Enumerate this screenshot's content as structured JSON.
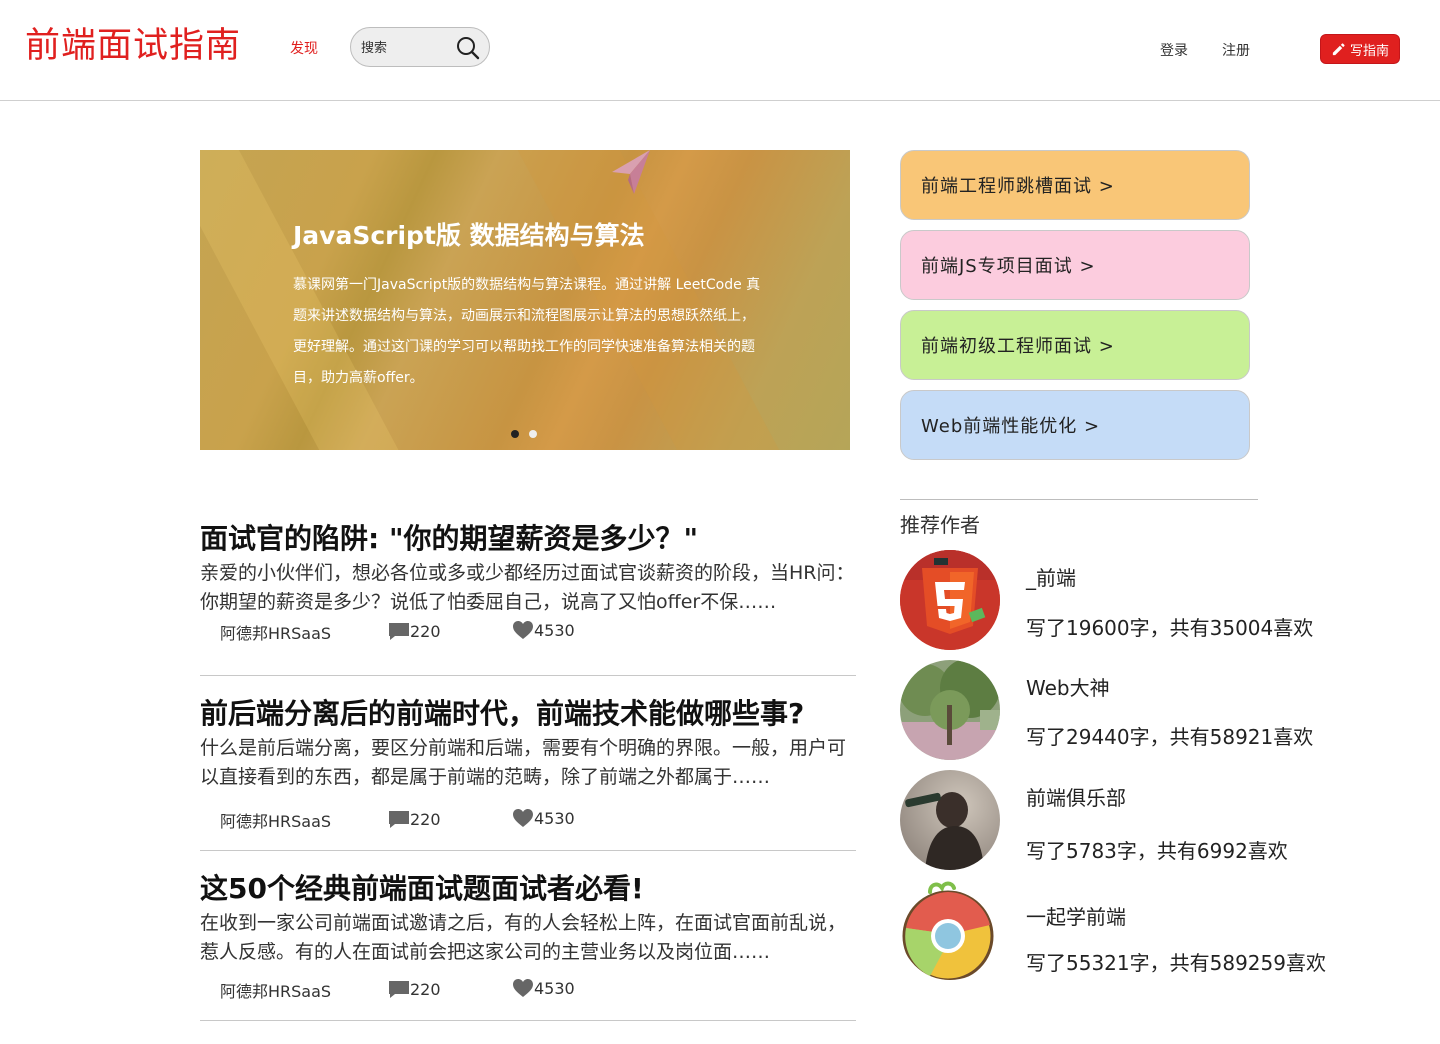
{
  "header": {
    "logo": "前端面试指南",
    "nav_discover": "发现",
    "search_placeholder": "搜索",
    "login": "登录",
    "register": "注册",
    "write_label": "写指南"
  },
  "banner": {
    "title": "JavaScript版 数据结构与算法",
    "description": "慕课网第一门JavaScript版的数据结构与算法课程。通过讲解 LeetCode 真题来讲述数据结构与算法，动画展示和流程图展示让算法的思想跃然纸上，更好理解。通过这门课的学习可以帮助找工作的同学快速准备算法相关的题目，助力高薪offer。",
    "active_slide": 1,
    "slide_count": 2
  },
  "categories": [
    {
      "label": "前端工程师跳槽面试 >",
      "color": "#f9c677"
    },
    {
      "label": "前端JS专项目面试 >",
      "color": "#fcccde"
    },
    {
      "label": "前端初级工程师面试 >",
      "color": "#c8f096"
    },
    {
      "label": "Web前端性能优化 >",
      "color": "#c5dcf7"
    }
  ],
  "articles": [
    {
      "title": "面试官的陷阱: \"你的期望薪资是多少？\"",
      "summary": "亲爱的小伙伴们，想必各位或多或少都经历过面试官谈薪资的阶段，当HR问：你期望的薪资是多少？说低了怕委屈自己，说高了又怕offer不保……",
      "author": "阿德邦HRSaaS",
      "comments": "220",
      "likes": "4530"
    },
    {
      "title": "前后端分离后的前端时代，前端技术能做哪些事?",
      "summary": "什么是前后端分离，要区分前端和后端，需要有个明确的界限。一般，用户可以直接看到的东西，都是属于前端的范畴，除了前端之外都属于……",
      "author": "阿德邦HRSaaS",
      "comments": "220",
      "likes": "4530"
    },
    {
      "title": "这50个经典前端面试题面试者必看!",
      "summary": "在收到一家公司前端面试邀请之后，有的人会轻松上阵，在面试官面前乱说，惹人反感。有的人在面试前会把这家公司的主营业务以及岗位面……",
      "author": "阿德邦HRSaaS",
      "comments": "220",
      "likes": "4530"
    }
  ],
  "authors_section": {
    "title": "推荐作者",
    "authors": [
      {
        "name": "_前端",
        "stats": "写了19600字，共有35004喜欢",
        "avatar": "html5-logo"
      },
      {
        "name": "Web大神",
        "stats": "写了29440字，共有58921喜欢",
        "avatar": "tree-photo"
      },
      {
        "name": "前端俱乐部",
        "stats": "写了5783字，共有6992喜欢",
        "avatar": "person-photo"
      },
      {
        "name": "一起学前端",
        "stats": "写了55321字，共有589259喜欢",
        "avatar": "chrome-logo"
      }
    ]
  }
}
